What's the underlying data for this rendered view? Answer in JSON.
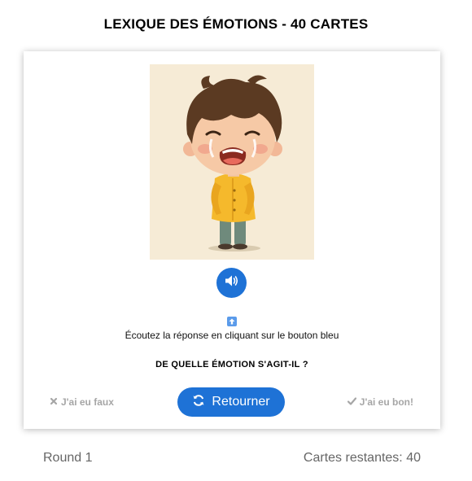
{
  "header": {
    "title": "LEXIQUE DES ÉMOTIONS - 40 CARTES"
  },
  "card": {
    "image_icon": "crying-child-illustration",
    "sound_icon": "speaker-icon",
    "hint_icon": "arrow-up-icon",
    "hint_text": "Écoutez la réponse en cliquant sur le bouton bleu",
    "question": "DE QUELLE ÉMOTION S'AGIT-IL ?",
    "wrong_label": "J'ai eu faux",
    "flip_label": "Retourner",
    "right_label": "J'ai eu bon!"
  },
  "footer": {
    "round": "Round 1",
    "remaining": "Cartes restantes: 40"
  },
  "colors": {
    "accent": "#1e72d6",
    "muted": "#a6a6a6",
    "illustration_bg": "#f6ebd6"
  }
}
